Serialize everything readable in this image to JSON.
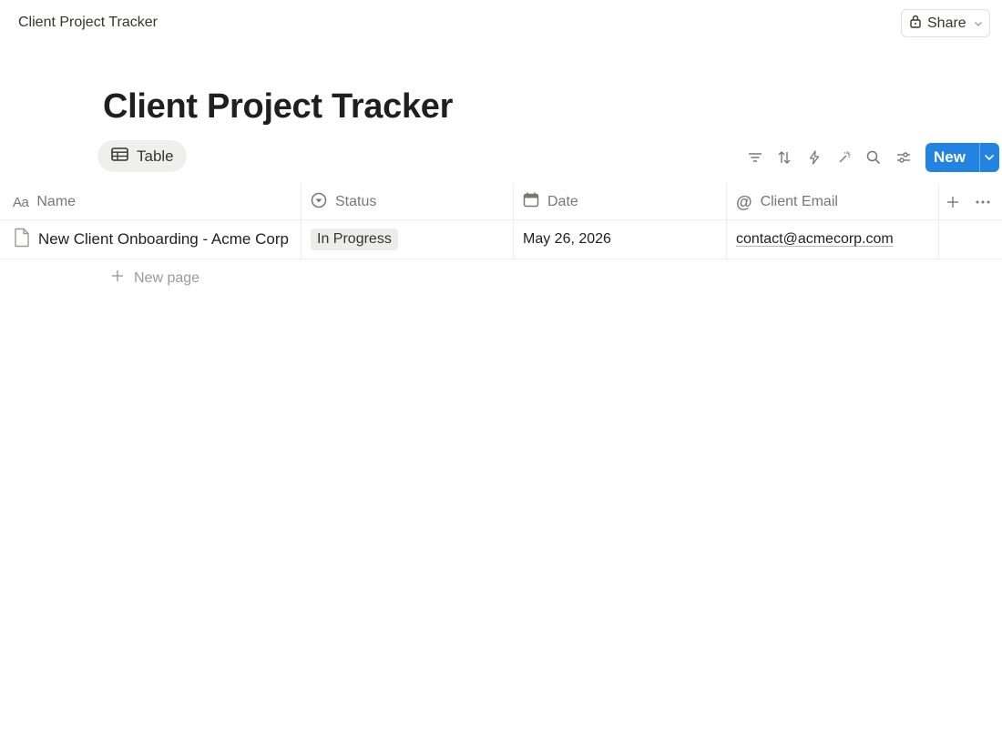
{
  "topbar": {
    "breadcrumb": "Client Project Tracker",
    "share_label": "Share"
  },
  "page": {
    "title": "Client Project Tracker"
  },
  "view": {
    "tab_label": "Table"
  },
  "toolbar": {
    "new_label": "New",
    "accent": "#2383e2"
  },
  "table": {
    "columns": [
      {
        "label": "Name",
        "icon": "text-aa-icon"
      },
      {
        "label": "Status",
        "icon": "status-icon"
      },
      {
        "label": "Date",
        "icon": "calendar-icon"
      },
      {
        "label": "Client Email",
        "icon": "at-icon"
      }
    ],
    "rows": [
      {
        "name": "New Client Onboarding - Acme Corp",
        "status": "In Progress",
        "date": "May 26, 2026",
        "email": "contact@acmecorp.com"
      }
    ],
    "new_page_label": "New page"
  }
}
